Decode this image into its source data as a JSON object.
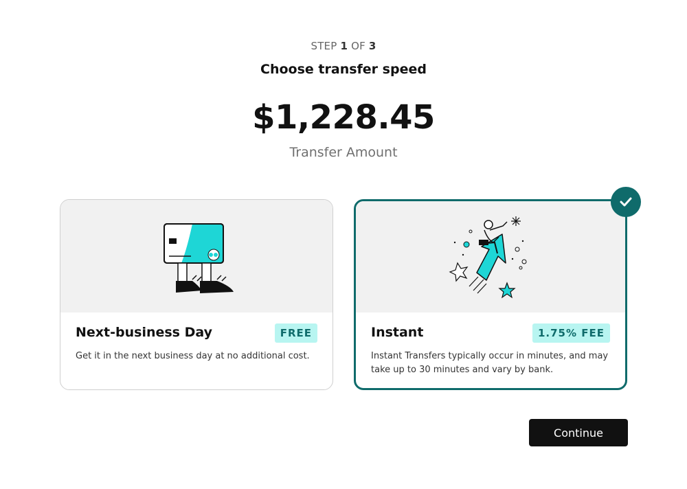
{
  "step": {
    "prefix": "STEP",
    "current": "1",
    "of": "OF",
    "total": "3"
  },
  "title": "Choose transfer speed",
  "amount": "$1,228.45",
  "amount_label": "Transfer Amount",
  "options": [
    {
      "title": "Next-business Day",
      "badge": "FREE",
      "description": "Get it in the next business day at no additional cost.",
      "illustration": "walking-card-illustration",
      "selected": false
    },
    {
      "title": "Instant",
      "badge": "1.75% FEE",
      "description": "Instant Transfers typically occur in minutes, and may take up to 30 minutes and vary by bank.",
      "illustration": "person-riding-arrow-illustration",
      "selected": true
    }
  ],
  "selected_icon": "check-icon",
  "continue_label": "Continue",
  "colors": {
    "accent": "#0f6b6b",
    "badge_bg": "#b8f5f1",
    "illustration_teal": "#1ed6d6",
    "button_bg": "#111111"
  }
}
